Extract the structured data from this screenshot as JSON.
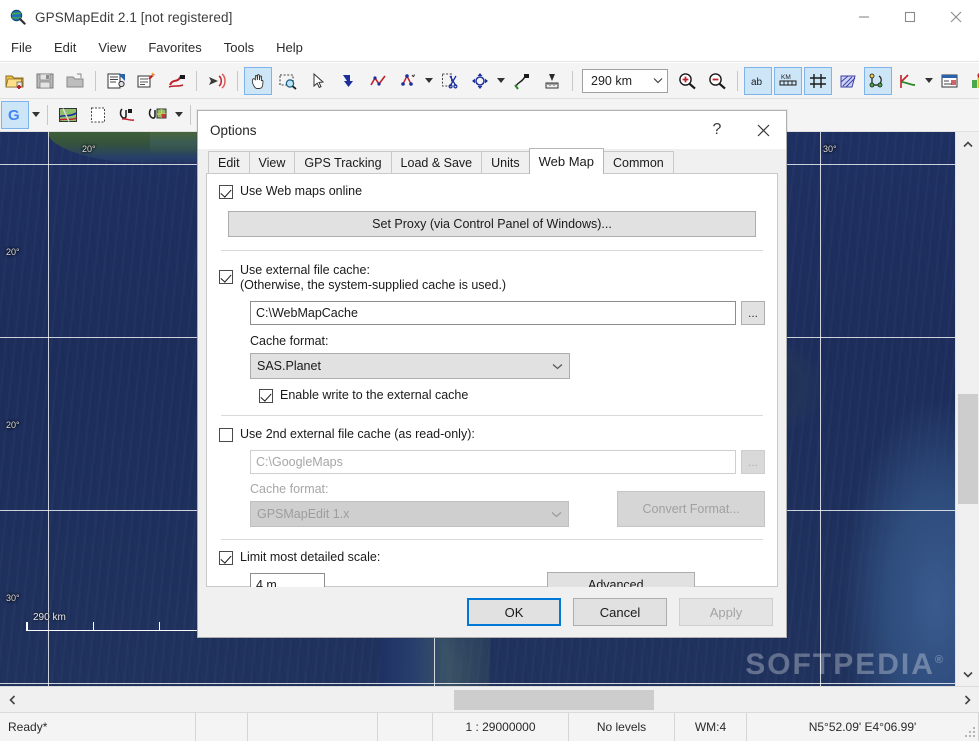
{
  "window": {
    "title": "GPSMapEdit 2.1 [not registered]",
    "icon": "globe-magnifier-icon",
    "controls": {
      "minimize": "minimize-icon",
      "maximize": "maximize-icon",
      "close": "close-icon"
    }
  },
  "menubar": {
    "items": [
      {
        "label": "File"
      },
      {
        "label": "Edit"
      },
      {
        "label": "View"
      },
      {
        "label": "Favorites"
      },
      {
        "label": "Tools"
      },
      {
        "label": "Help"
      }
    ]
  },
  "toolbar_main": {
    "scale_value": "290 km",
    "buttons": [
      {
        "name": "open-file-icon"
      },
      {
        "name": "save-file-icon"
      },
      {
        "name": "save-as-icon"
      },
      {
        "name": "map-properties-icon"
      },
      {
        "name": "map-wizard-icon"
      },
      {
        "name": "route-properties-icon"
      },
      {
        "name": "send-to-gps-icon"
      },
      {
        "name": "pan-hand-icon"
      },
      {
        "name": "zoom-select-icon"
      },
      {
        "name": "select-arrow-icon"
      },
      {
        "name": "create-polygon-icon"
      },
      {
        "name": "create-polyline-icon"
      },
      {
        "name": "create-point-icon"
      },
      {
        "name": "split-object-icon"
      },
      {
        "name": "move-object-icon"
      },
      {
        "name": "add-node-icon"
      },
      {
        "name": "measure-icon"
      },
      {
        "name": "zoom-in-icon"
      },
      {
        "name": "zoom-out-icon"
      },
      {
        "name": "show-labels-icon"
      },
      {
        "name": "show-scalebar-icon"
      },
      {
        "name": "show-grid-icon"
      },
      {
        "name": "show-hatching-icon"
      },
      {
        "name": "show-nodes-icon"
      },
      {
        "name": "show-direction-icon"
      },
      {
        "name": "object-list-icon"
      },
      {
        "name": "show-poi-icon"
      }
    ]
  },
  "toolbar_web": {
    "buttons": [
      {
        "name": "google-web-map-icon"
      },
      {
        "name": "load-map-image-icon"
      },
      {
        "name": "new-blank-map-icon"
      },
      {
        "name": "attach-route-icon"
      },
      {
        "name": "attach-map-icon"
      }
    ]
  },
  "map": {
    "scalebar_label": "290 km",
    "graticule_labels": [
      "20°",
      "30°",
      "20°",
      "20°",
      "30°",
      "20°"
    ],
    "watermark": "SOFTPEDIA",
    "watermark_mark": "®"
  },
  "dialog": {
    "title": "Options",
    "help_glyph": "?",
    "close_glyph": "close-icon",
    "tabs": [
      {
        "label": "Edit",
        "active": false
      },
      {
        "label": "View",
        "active": false
      },
      {
        "label": "GPS Tracking",
        "active": false
      },
      {
        "label": "Load & Save",
        "active": false
      },
      {
        "label": "Units",
        "active": false
      },
      {
        "label": "Web Map",
        "active": true
      },
      {
        "label": "Common",
        "active": false
      }
    ],
    "web_map": {
      "use_web_maps": {
        "label": "Use Web maps online",
        "checked": true
      },
      "set_proxy_button": "Set Proxy (via Control Panel of Windows)...",
      "external_cache": {
        "label_line1": "Use external file cache:",
        "label_line2": "(Otherwise, the system-supplied cache is used.)",
        "checked": true,
        "path_value": "C:\\WebMapCache",
        "browse_label": "...",
        "format_label": "Cache format:",
        "format_value": "SAS.Planet",
        "enable_write": {
          "label": "Enable write to the external cache",
          "checked": true
        }
      },
      "second_cache": {
        "label": "Use 2nd external file cache (as read-only):",
        "checked": false,
        "path_value": "C:\\GoogleMaps",
        "browse_label": "...",
        "format_label": "Cache format:",
        "format_value": "GPSMapEdit 1.x",
        "convert_button": "Convert Format..."
      },
      "limit_scale": {
        "label": "Limit most detailed scale:",
        "checked": true,
        "value": "4 m",
        "advanced_button": "Advanced..."
      }
    },
    "footer": {
      "ok": "OK",
      "cancel": "Cancel",
      "apply": "Apply"
    }
  },
  "statusbar": {
    "ready": "Ready*",
    "blank1": "",
    "blank2": "",
    "blank3": "",
    "scale": "1 : 29000000",
    "levels": "No levels",
    "wm": "WM:4",
    "coords": "N5°52.09' E4°06.99'"
  },
  "colors": {
    "accent": "#0078d7",
    "toolbar_active": "#cde6f7",
    "dialog_bg": "#f0f0f0",
    "ocean": "#1f3164",
    "land": "#5c6e3e"
  }
}
